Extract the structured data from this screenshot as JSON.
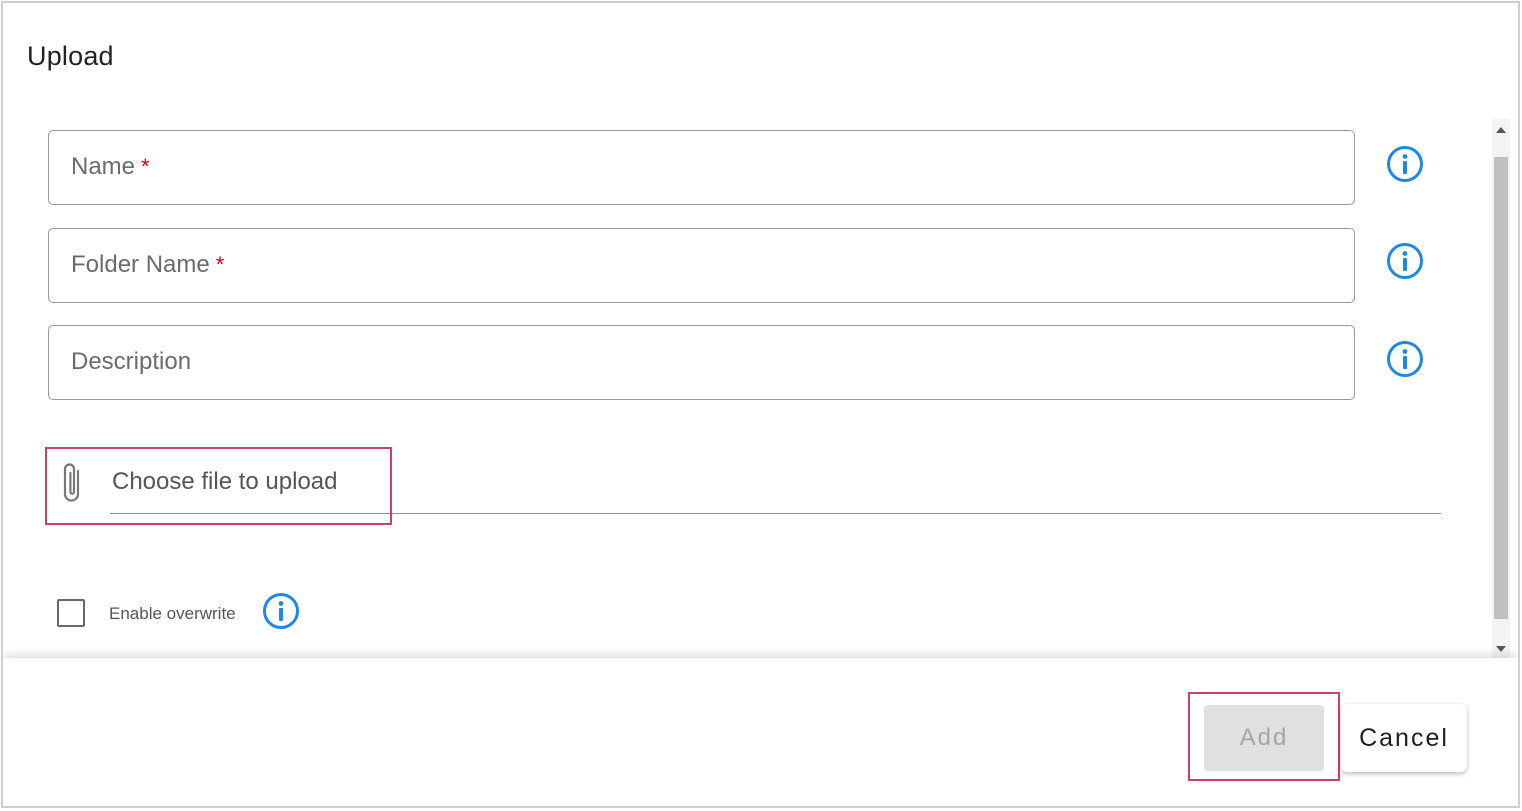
{
  "dialog": {
    "title": "Upload"
  },
  "form": {
    "name_label": "Name",
    "folder_name_label": "Folder Name",
    "description_label": "Description",
    "required_marker": "*",
    "upload_label": "Choose file to upload",
    "overwrite_label": "Enable overwrite",
    "overwrite_checked": false
  },
  "footer": {
    "add_label": "Add",
    "cancel_label": "Cancel",
    "add_disabled": true
  },
  "icons": {
    "info": "info-icon",
    "attachment": "paperclip-icon",
    "scroll_up": "arrow-up-icon",
    "scroll_down": "arrow-down-icon"
  },
  "colors": {
    "info_blue": "#1e88e5",
    "required_red": "#d0021b",
    "highlight": "#c7426b",
    "disabled_bg": "#e0e0e0",
    "disabled_text": "#a6a6a6"
  }
}
